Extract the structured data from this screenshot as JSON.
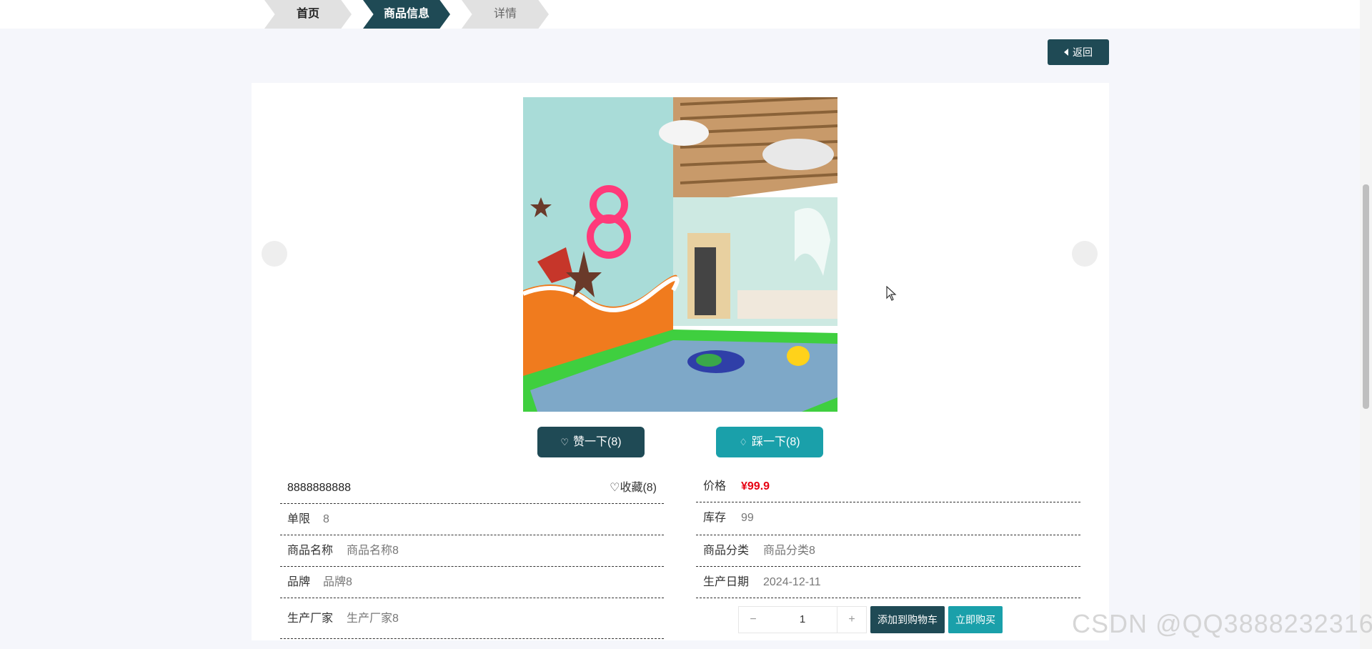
{
  "breadcrumb": {
    "items": [
      {
        "label": "首页"
      },
      {
        "label": "商品信息"
      },
      {
        "label": "详情"
      }
    ]
  },
  "back_button": {
    "label": "返回"
  },
  "votes": {
    "like_label": "赞一下(8)",
    "dislike_label": "踩一下(8)"
  },
  "product": {
    "title": "8888888888",
    "favorite_label": "收藏(8)",
    "price_label": "价格",
    "price_value": "¥99.9",
    "limit_label": "单限",
    "limit_value": "8",
    "stock_label": "库存",
    "stock_value": "99",
    "name_label": "商品名称",
    "name_value": "商品名称8",
    "category_label": "商品分类",
    "category_value": "商品分类8",
    "brand_label": "品牌",
    "brand_value": "品牌8",
    "date_label": "生产日期",
    "date_value": "2024-12-11",
    "maker_label": "生产厂家",
    "maker_value": "生产厂家8"
  },
  "purchase": {
    "minus": "−",
    "quantity": "1",
    "plus": "+",
    "add_to_cart": "添加到购物车",
    "buy_now": "立即购买"
  },
  "watermark": "CSDN @QQ3888232316",
  "colors": {
    "primary": "#1f4a55",
    "accent": "#1aa0aa",
    "price": "#e60012",
    "background": "#f5f6fb"
  },
  "icons": [
    "arrow-left-icon",
    "like-icon",
    "dislike-icon",
    "heart-icon",
    "cursor-icon"
  ]
}
